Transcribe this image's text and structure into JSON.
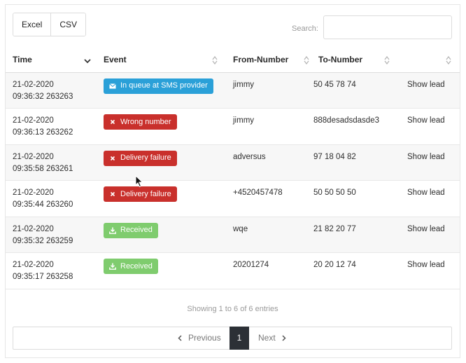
{
  "toolbar": {
    "excel_label": "Excel",
    "csv_label": "CSV"
  },
  "search": {
    "label": "Search:",
    "value": "",
    "placeholder": ""
  },
  "table": {
    "columns": [
      "Time",
      "Event",
      "From-Number",
      "To-Number",
      ""
    ],
    "rows": [
      {
        "date": "21-02-2020",
        "time": "09:36:32 263263",
        "event": "In queue at SMS provider",
        "event_type": "info",
        "event_icon": "envelope-icon",
        "from": "jimmy",
        "to": "50 45 78 74",
        "action": "Show lead"
      },
      {
        "date": "21-02-2020",
        "time": "09:36:13 263262",
        "event": "Wrong number",
        "event_type": "danger",
        "event_icon": "x-icon",
        "from": "jimmy",
        "to": "888desadsdasde3",
        "action": "Show lead"
      },
      {
        "date": "21-02-2020",
        "time": "09:35:58 263261",
        "event": "Delivery failure",
        "event_type": "danger",
        "event_icon": "x-icon",
        "from": "adversus",
        "to": "97 18 04 82",
        "action": "Show lead"
      },
      {
        "date": "21-02-2020",
        "time": "09:35:44 263260",
        "event": "Delivery failure",
        "event_type": "danger",
        "event_icon": "x-icon",
        "from": "+4520457478",
        "to": "50 50 50 50",
        "action": "Show lead"
      },
      {
        "date": "21-02-2020",
        "time": "09:35:32 263259",
        "event": "Received",
        "event_type": "success",
        "event_icon": "download-icon",
        "from": "wqe",
        "to": "21 82 20 77",
        "action": "Show lead"
      },
      {
        "date": "21-02-2020",
        "time": "09:35:17 263258",
        "event": "Received",
        "event_type": "success",
        "event_icon": "download-icon",
        "from": "20201274",
        "to": "20 20 12 74",
        "action": "Show lead"
      }
    ]
  },
  "info": "Showing 1 to 6 of 6 entries",
  "pagination": {
    "previous": "Previous",
    "current": "1",
    "next": "Next"
  },
  "colors": {
    "info": "#2aa0d8",
    "danger": "#c9302c",
    "success": "#7fcc6e",
    "active_page": "#2c3036"
  }
}
